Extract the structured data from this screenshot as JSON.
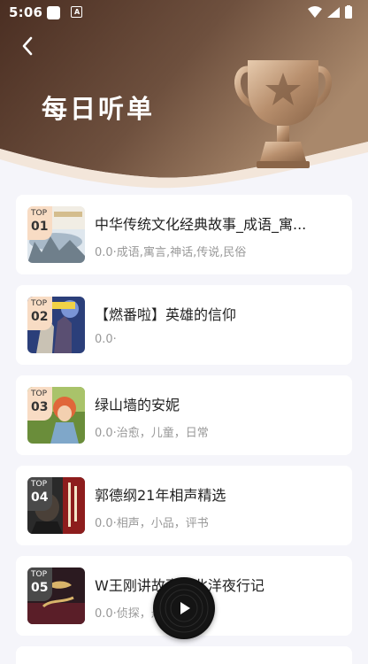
{
  "status_bar": {
    "time": "5:06"
  },
  "header": {
    "title": "每日听单",
    "colors": {
      "gradient_dark": "#4a2e22",
      "gradient_light": "#a9886b",
      "trophy": "#c9a27c"
    }
  },
  "list": {
    "items": [
      {
        "rank_label": "TOP",
        "rank": "01",
        "title": "中华传统文化经典故事_成语_寓...",
        "meta": "0.0·成语,寓言,神话,传说,民俗"
      },
      {
        "rank_label": "TOP",
        "rank": "02",
        "title": "【燃番啦】英雄的信仰",
        "meta": "0.0·"
      },
      {
        "rank_label": "TOP",
        "rank": "03",
        "title": "绿山墙的安妮",
        "meta": "0.0·治愈，儿童，日常"
      },
      {
        "rank_label": "TOP",
        "rank": "04",
        "title": "郭德纲21年相声精选",
        "meta": "0.0·相声，小品，评书"
      },
      {
        "rank_label": "TOP",
        "rank": "05",
        "title": "W王刚讲故事：北洋夜行记",
        "meta": "0.0·侦探，悬疑"
      }
    ]
  },
  "player": {
    "icon": "play-icon"
  }
}
